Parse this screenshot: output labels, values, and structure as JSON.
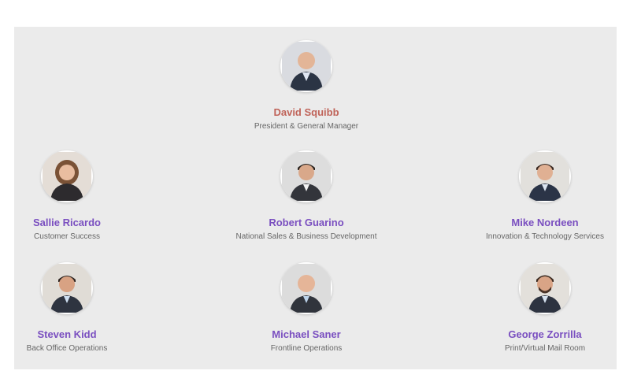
{
  "org_chart": {
    "leader": {
      "name": "David Squibb",
      "role": "President & General Manager",
      "avatar_icon": "person-photo-icon",
      "name_color": "#c0645a"
    },
    "members": [
      {
        "name": "Sallie Ricardo",
        "role": "Customer Success",
        "avatar_icon": "person-photo-icon"
      },
      {
        "name": "Robert Guarino",
        "role": "National Sales & Business Development",
        "avatar_icon": "person-photo-icon"
      },
      {
        "name": "Mike Nordeen",
        "role": "Innovation & Technology Services",
        "avatar_icon": "person-photo-icon"
      },
      {
        "name": "Steven Kidd",
        "role": "Back Office Operations",
        "avatar_icon": "person-photo-icon"
      },
      {
        "name": "Michael Saner",
        "role": "Frontline Operations",
        "avatar_icon": "person-photo-icon"
      },
      {
        "name": "George Zorrilla",
        "role": "Print/Virtual Mail Room",
        "avatar_icon": "person-photo-icon"
      }
    ],
    "member_name_color": "#7a4fc0"
  }
}
